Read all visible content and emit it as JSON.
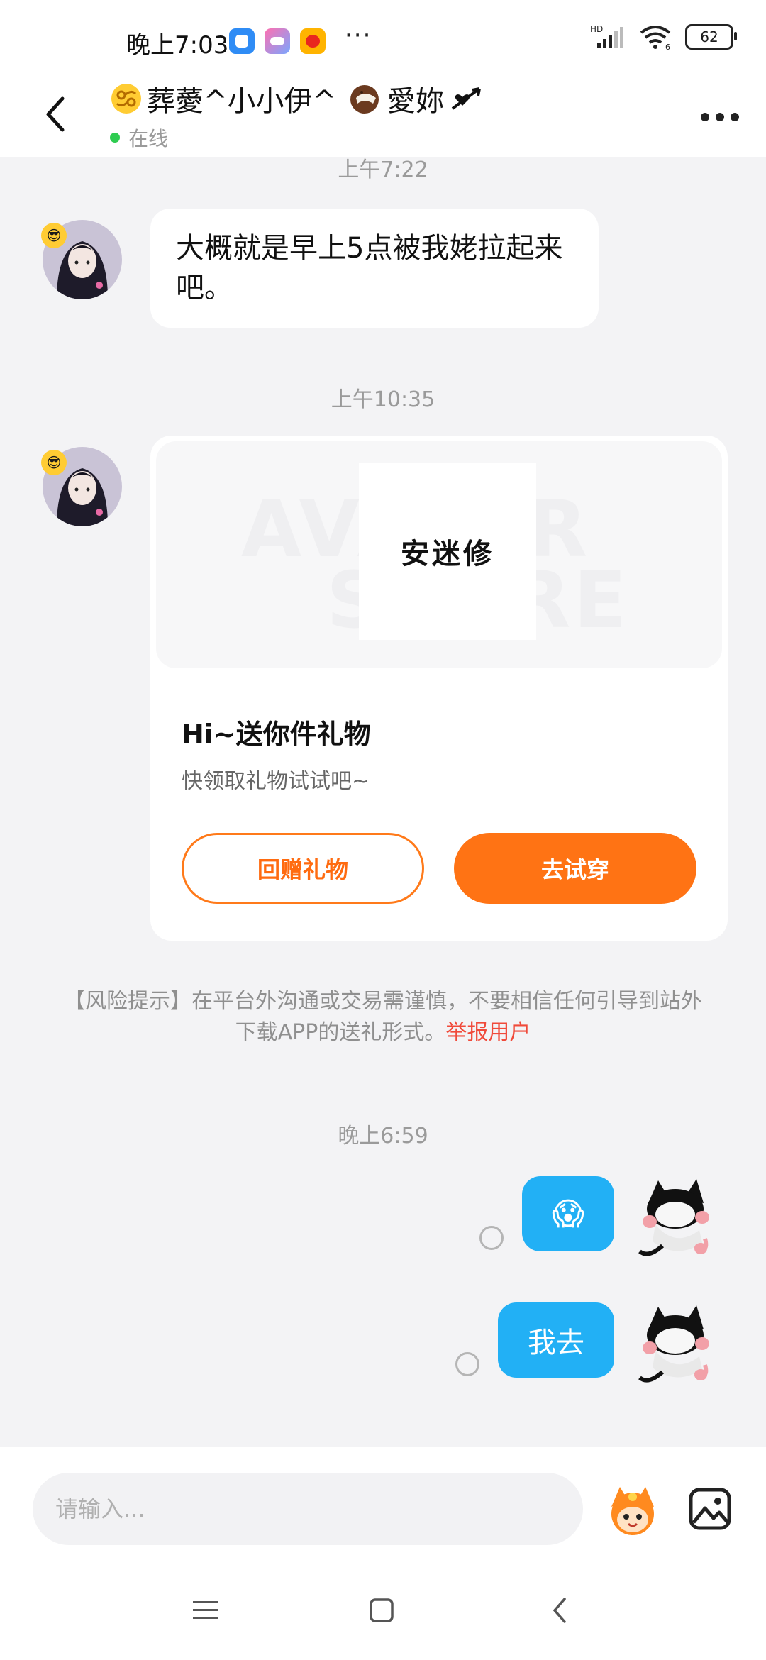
{
  "status_bar": {
    "time": "晚上7:03",
    "overflow": "···",
    "network": "HD",
    "battery": "62",
    "icons": [
      "app-icon-blue",
      "game-icon",
      "weibo-icon",
      "signal-icon",
      "wifi-icon",
      "battery-icon"
    ]
  },
  "header": {
    "title_prefix_icon": "cancer-zodiac-icon",
    "title_main": "葬薆^小小伊^",
    "title_coconut_icon": "coconut-icon",
    "title_suffix": "愛妳",
    "title_arrow_icon": "heart-arrow-icon",
    "status": "在线"
  },
  "messages": {
    "time1": "上午7:22",
    "msg1": "大概就是早上5点被我姥拉起来吧。",
    "time2": "上午10:35",
    "card": {
      "image_text": "安迷修",
      "ghost_text_1": "AVATAR",
      "ghost_text_2": "STORE",
      "title": "Hi~送你件礼物",
      "subtitle": "快领取礼物试试吧~",
      "btn_return": "回赠礼物",
      "btn_try": "去试穿"
    },
    "risk_text": "【风险提示】在平台外沟通或交易需谨慎，不要相信任何引导到站外下载APP的送礼形式。",
    "risk_link": "举报用户",
    "time3": "晚上6:59",
    "out1_emoji": "😱",
    "out2": "我去"
  },
  "input": {
    "placeholder": "请输入..."
  },
  "colors": {
    "accent_orange": "#ff7314",
    "bubble_blue": "#22b0f5",
    "online_green": "#2ecc51",
    "risk_link_red": "#f04a3a"
  }
}
